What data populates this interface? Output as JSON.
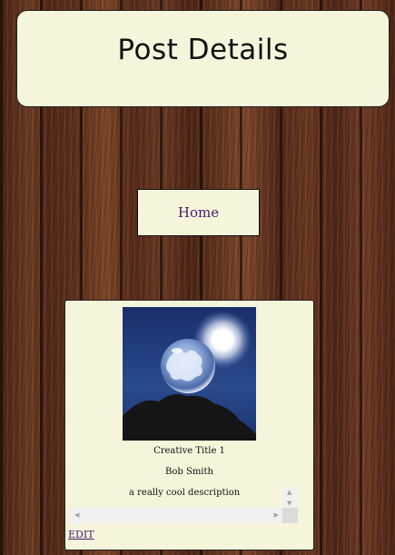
{
  "header": {
    "title": "Post Details"
  },
  "nav": {
    "home_label": "Home"
  },
  "post": {
    "title": "Creative Title 1",
    "author": "Bob Smith",
    "description": "a really cool description",
    "image_alt": "soap bubble against sun",
    "edit_label": "EDIT"
  },
  "colors": {
    "panel_bg": "#f5f5dc",
    "link": "#4a1a6b"
  }
}
